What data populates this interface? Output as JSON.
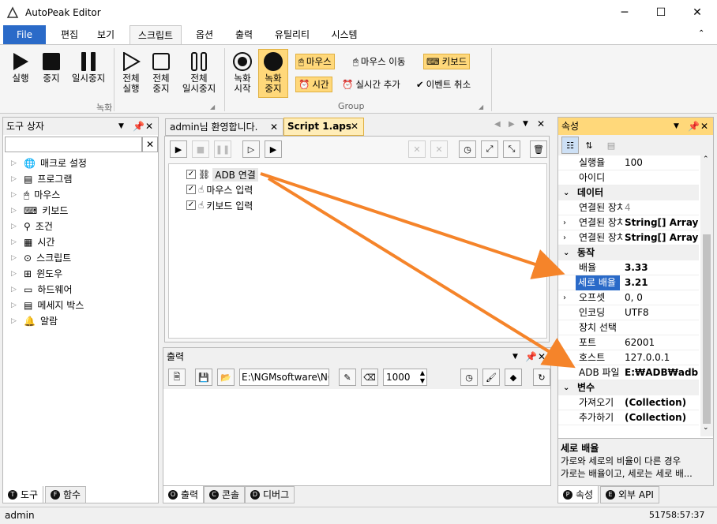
{
  "window": {
    "title": "AutoPeak Editor",
    "min": "─",
    "max": "☐",
    "close": "✕"
  },
  "menu": {
    "file": "File",
    "items": [
      "편집",
      "보기",
      "스크립트",
      "옵션",
      "출력",
      "유틸리티",
      "시스템"
    ]
  },
  "ribbon": {
    "run": "실행",
    "stop": "중지",
    "pause": "일시중지",
    "all_run": [
      "전체",
      "실행"
    ],
    "all_stop": [
      "전체",
      "중지"
    ],
    "all_pause": [
      "전체",
      "일시중지"
    ],
    "group1": "녹화",
    "rec_start": [
      "녹화",
      "시작"
    ],
    "rec_stop": [
      "녹화",
      "중지"
    ],
    "mouse": "마우스",
    "mouse_move": "마우스 이동",
    "keyboard": "키보드",
    "time": "시간",
    "add_realtime": "실시간 추가",
    "cancel_event": "이벤트 취소",
    "group2": "Group"
  },
  "toolbox": {
    "title": "도구 상자",
    "items": [
      "매크로 설정",
      "프로그램",
      "마우스",
      "키보드",
      "조건",
      "시간",
      "스크립트",
      "윈도우",
      "하드웨어",
      "메세지 박스",
      "알람"
    ],
    "tabs": [
      "도구",
      "함수"
    ],
    "tab_keys": [
      "T",
      "F"
    ]
  },
  "editor": {
    "tabs": [
      "admin님 환영합니다.",
      "Script 1.aps"
    ],
    "nodes": [
      "ADB 연결",
      "마우스 입력",
      "키보드 입력"
    ]
  },
  "output": {
    "title": "출력",
    "path": "E:\\NGMsoftware\\NG",
    "count": "1000",
    "tabs": [
      "출력",
      "콘솔",
      "디버그"
    ],
    "tab_keys": [
      "O",
      "C",
      "D"
    ]
  },
  "props": {
    "title": "속성",
    "rows": [
      {
        "k": "실행율",
        "v": "100",
        "type": "row"
      },
      {
        "k": "아이디",
        "v": "",
        "type": "row"
      },
      {
        "k": "데이터",
        "type": "cat"
      },
      {
        "k": "연결된 장치",
        "v": "4",
        "type": "row",
        "gray": true
      },
      {
        "k": "연결된 장치",
        "v": "String[] Array",
        "type": "row",
        "bold": true,
        "exp": true
      },
      {
        "k": "연결된 장치",
        "v": "String[] Array",
        "type": "row",
        "bold": true,
        "exp": true
      },
      {
        "k": "동작",
        "type": "cat"
      },
      {
        "k": "배율",
        "v": "3.33",
        "type": "row",
        "bold": true
      },
      {
        "k": "세로 배율",
        "v": "3.21",
        "type": "row",
        "bold": true,
        "sel": true
      },
      {
        "k": "오프셋",
        "v": "0, 0",
        "type": "row",
        "exp": true
      },
      {
        "k": "인코딩",
        "v": "UTF8",
        "type": "row"
      },
      {
        "k": "장치 선택",
        "v": "",
        "type": "row"
      },
      {
        "k": "포트",
        "v": "62001",
        "type": "row"
      },
      {
        "k": "호스트",
        "v": "127.0.0.1",
        "type": "row"
      },
      {
        "k": "ADB 파일",
        "v": "E:₩ADB₩adb.exe",
        "type": "row",
        "bold": true
      },
      {
        "k": "변수",
        "type": "cat"
      },
      {
        "k": "가져오기",
        "v": "(Collection)",
        "type": "row",
        "bold": true
      },
      {
        "k": "추가하기",
        "v": "(Collection)",
        "type": "row",
        "bold": true
      }
    ],
    "desc_title": "세로 배율",
    "desc_line1": "가로와 세로의 비율이 다른 경우",
    "desc_line2": "가로는 배율이고, 세로는 세로 배...",
    "tabs": [
      "속성",
      "외부 API"
    ],
    "tab_keys": [
      "P",
      "E"
    ]
  },
  "status": {
    "user": "admin",
    "coords": "51758:57:37"
  },
  "colors": {
    "accent": "#2a6ac8",
    "highlight": "#ffd87a",
    "arrow": "#f5842a",
    "select": "#2a6ac8"
  }
}
